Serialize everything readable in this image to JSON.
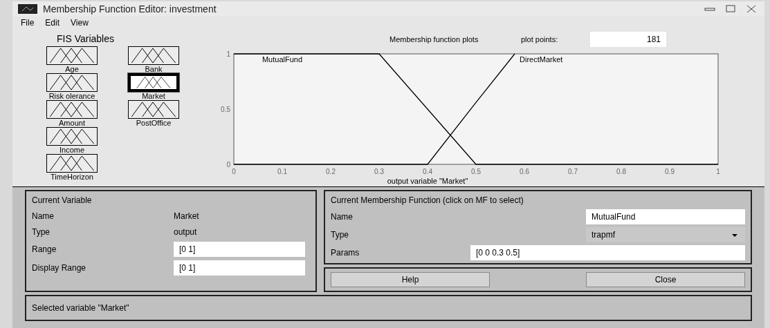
{
  "window": {
    "title": "Membership Function Editor: investment"
  },
  "menu": [
    "File",
    "Edit",
    "View"
  ],
  "fis_variables": {
    "title": "FIS Variables",
    "inputs": [
      {
        "label": "Age",
        "selected": false
      },
      {
        "label": "Risk olerance",
        "selected": false
      },
      {
        "label": "Amount",
        "selected": false
      },
      {
        "label": "Income",
        "selected": false
      },
      {
        "label": "TimeHorizon",
        "selected": false
      }
    ],
    "outputs": [
      {
        "label": "Bank",
        "selected": false
      },
      {
        "label": "Market",
        "selected": true
      },
      {
        "label": "PostOffice",
        "selected": false
      }
    ]
  },
  "plot": {
    "title": "Membership function plots",
    "plot_points_label": "plot points:",
    "plot_points": "181",
    "chart_data": {
      "type": "line",
      "xlabel": "output variable \"Market\"",
      "x": [
        0,
        0.3,
        0.4,
        0.5,
        0.58,
        1
      ],
      "series": [
        {
          "name": "MutualFund",
          "color": "#000000",
          "values": [
            1,
            1,
            0.5,
            0,
            0,
            0
          ]
        },
        {
          "name": "DirectMarket",
          "color": "#000000",
          "values": [
            0,
            0,
            0,
            0.56,
            1,
            null
          ]
        }
      ],
      "xlim": [
        0,
        1
      ],
      "ylim": [
        0,
        1
      ],
      "xticks": [
        0,
        0.1,
        0.2,
        0.3,
        0.4,
        0.5,
        0.6,
        0.7,
        0.8,
        0.9,
        1
      ],
      "yticks": [
        0,
        0.5,
        1
      ]
    }
  },
  "current_variable": {
    "title": "Current Variable",
    "name_label": "Name",
    "name": "Market",
    "type_label": "Type",
    "type": "output",
    "range_label": "Range",
    "range": "[0 1]",
    "display_range_label": "Display Range",
    "display_range": "[0 1]"
  },
  "current_mf": {
    "title": "Current Membership Function (click on MF to select)",
    "name_label": "Name",
    "name": "MutualFund",
    "type_label": "Type",
    "type": "trapmf",
    "params_label": "Params",
    "params": "[0 0 0.3 0.5]"
  },
  "buttons": [
    "Help",
    "Close"
  ],
  "status": "Selected variable \"Market\""
}
